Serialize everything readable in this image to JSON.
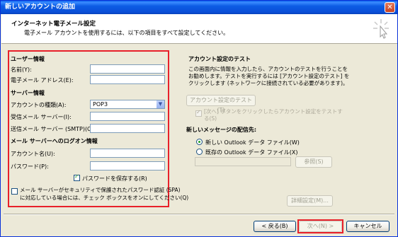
{
  "window": {
    "title": "新しいアカウントの追加",
    "close_symbol": "✕"
  },
  "header": {
    "title": "インターネット電子メール設定",
    "subtitle": "電子メール アカウントを使用するには、以下の項目をすべて設定してください。"
  },
  "user_info": {
    "heading": "ユーザー情報",
    "name_label": "名前(Y):",
    "name_value": "",
    "email_label": "電子メール アドレス(E):",
    "email_value": ""
  },
  "server_info": {
    "heading": "サーバー情報",
    "account_type_label": "アカウントの種類(A):",
    "account_type_value": "POP3",
    "incoming_label": "受信メール サーバー(I):",
    "incoming_value": "",
    "outgoing_label": "送信メール サーバー (SMTP)(O):",
    "outgoing_value": ""
  },
  "logon_info": {
    "heading": "メール サーバーへのログオン情報",
    "account_name_label": "アカウント名(U):",
    "account_name_value": "",
    "password_label": "パスワード(P):",
    "password_value": "",
    "save_password_label": "パスワードを保存する(R)",
    "save_password_checked": true,
    "spa_label_line1": "メール サーバーがセキュリティで保護されたパスワード認証 (SPA)",
    "spa_label_line2": "に対応している場合には、チェック ボックスをオンにしてください(Q)",
    "spa_checked": false
  },
  "account_test": {
    "heading": "アカウント設定のテスト",
    "description_line1": "この画面内に情報を入力したら、アカウントのテストを行うことを",
    "description_line2": "お勧めします。テストを実行するには [アカウント設定のテスト] を",
    "description_line3": "クリックします (ネットワークに接続されている必要があります)。",
    "test_button": "アカウント設定のテスト(T)",
    "auto_test_line1": "[次へ] ボタンをクリックしたらアカウント設定をテストす",
    "auto_test_line2": "る(S)",
    "auto_test_checked": true
  },
  "delivery": {
    "heading": "新しいメッセージの配信先:",
    "option_new": "新しい Outlook データ ファイル(W)",
    "option_existing": "既存の Outlook データ ファイル(X)",
    "selected": "new",
    "file_path_value": "",
    "browse_button": "参照(S)"
  },
  "buttons": {
    "more_settings": "詳細設定(M)...",
    "back": "< 戻る(B)",
    "next": "次へ(N) >",
    "cancel": "キャンセル"
  }
}
